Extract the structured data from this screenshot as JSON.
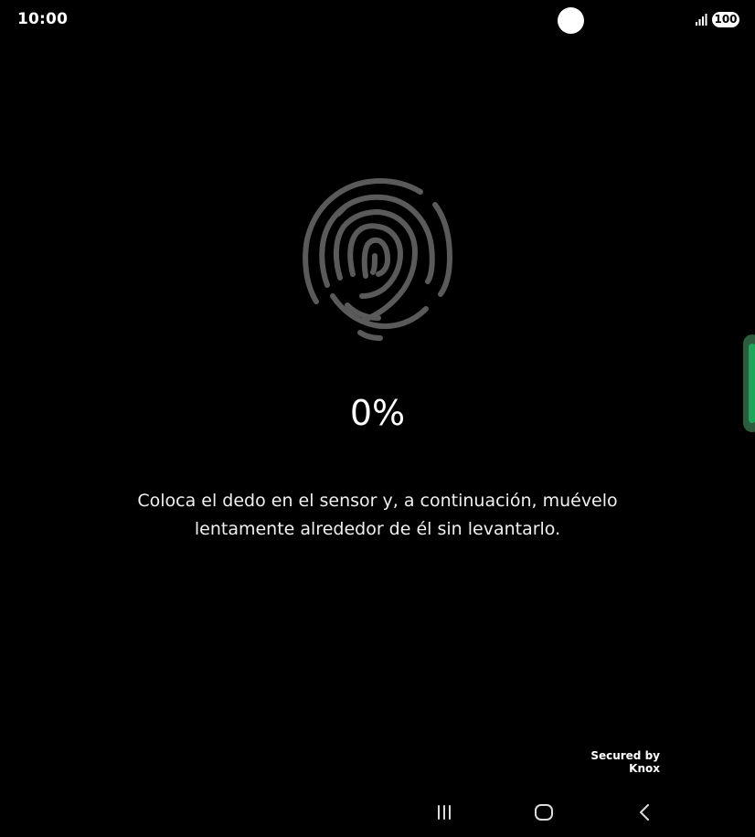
{
  "status_bar": {
    "time": "10:00",
    "battery": "100",
    "signal_icon": "signal-bars-icon"
  },
  "enrollment": {
    "icon": "fingerprint-icon",
    "progress_percent": "0%",
    "progress_value": 0,
    "instruction": "Coloca el dedo en el sensor y, a continuación, muévelo lentamente alrededor de él sin levantarlo."
  },
  "footer": {
    "secured_by_line1": "Secured by",
    "secured_by_line2": "Knox"
  },
  "nav_bar": {
    "recents_icon": "recents-icon",
    "home_icon": "home-icon",
    "back_icon": "back-icon"
  },
  "colors": {
    "background": "#000000",
    "fingerprint": "#5a5a5a",
    "side_handle": "#1fa65a"
  }
}
